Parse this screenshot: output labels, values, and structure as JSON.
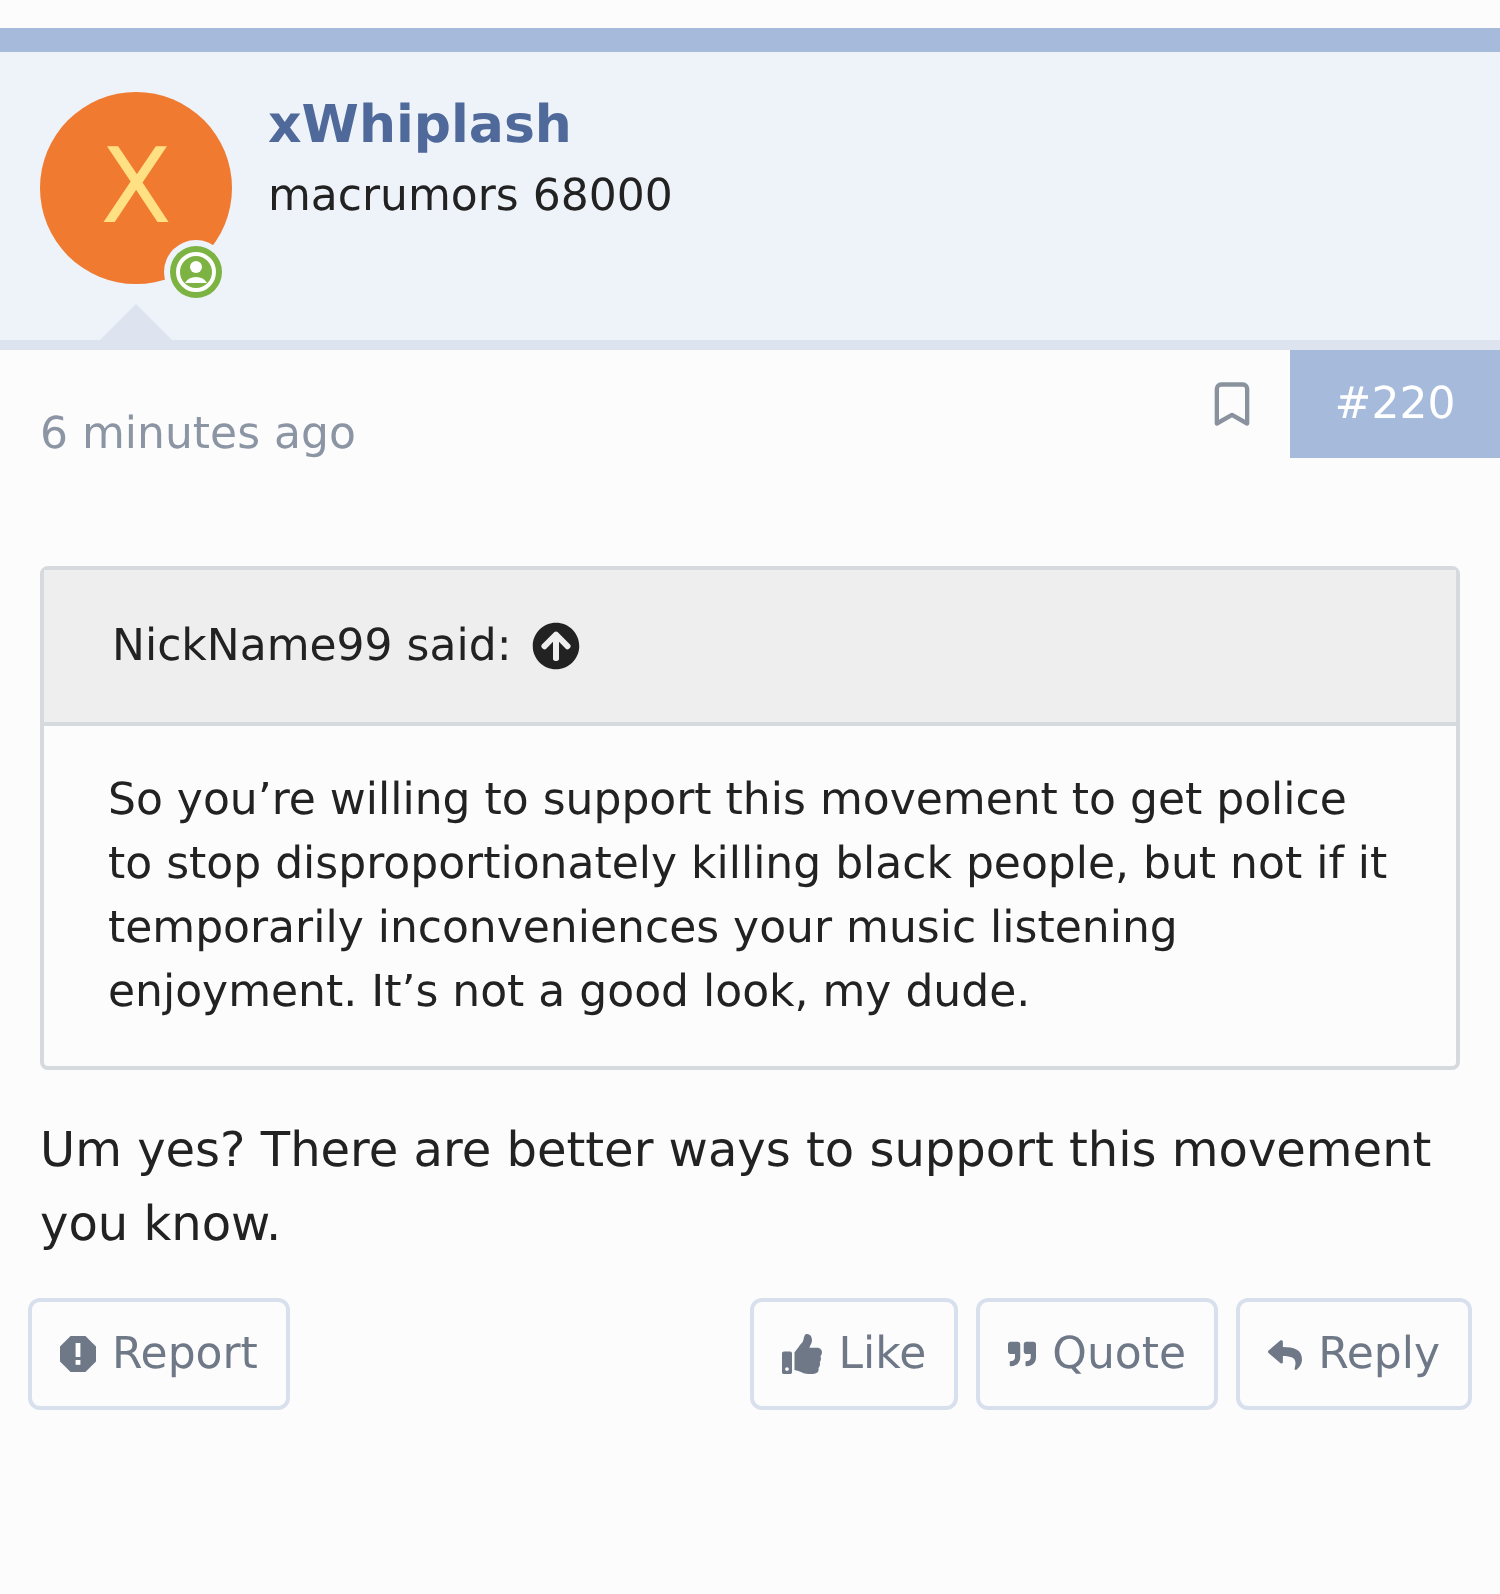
{
  "author": {
    "name": "xWhiplash",
    "rank": "macrumors 68000",
    "avatar_letter": "X",
    "online": true
  },
  "time": "6 minutes ago",
  "post_number": "#220",
  "quote": {
    "attribution": "NickName99 said:",
    "text": "So you’re willing to support this movement to get police to stop disproportionately killing black people, but not if it temporarily inconveniences your music listening enjoyment. It’s not a good look, my dude."
  },
  "message": "Um yes? There are better ways to support this movement you know.",
  "actions_left": [
    {
      "kind": "report",
      "label": "Report"
    }
  ],
  "actions_right": [
    {
      "kind": "like",
      "label": "Like"
    },
    {
      "kind": "quote",
      "label": "Quote"
    },
    {
      "kind": "reply",
      "label": "Reply"
    }
  ]
}
